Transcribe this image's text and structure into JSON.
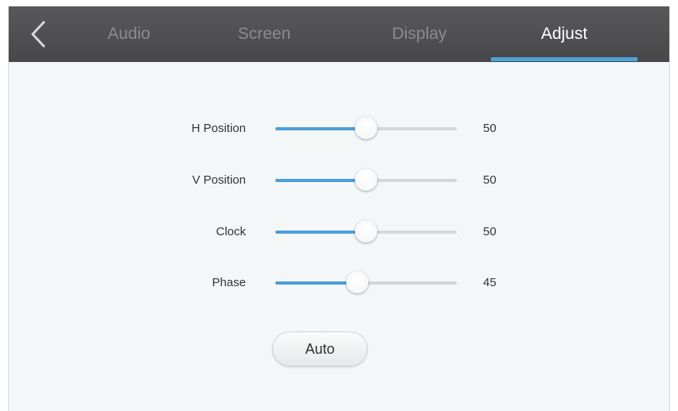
{
  "tabs": [
    {
      "label": "Audio",
      "active": false
    },
    {
      "label": "Screen",
      "active": false
    },
    {
      "label": "Display",
      "active": false
    },
    {
      "label": "Adjust",
      "active": true
    }
  ],
  "icons": {
    "back": "chevron-left-icon"
  },
  "colors": {
    "accent": "#4a9fd8",
    "topbar": "#4f4f51",
    "background": "#f4f7f8"
  },
  "sliders": [
    {
      "label": "H Position",
      "value": "50",
      "fraction": 0.5
    },
    {
      "label": "V Position",
      "value": "50",
      "fraction": 0.5
    },
    {
      "label": "Clock",
      "value": "50",
      "fraction": 0.5
    },
    {
      "label": "Phase",
      "value": "45",
      "fraction": 0.45
    }
  ],
  "auto_button": {
    "label": "Auto"
  }
}
